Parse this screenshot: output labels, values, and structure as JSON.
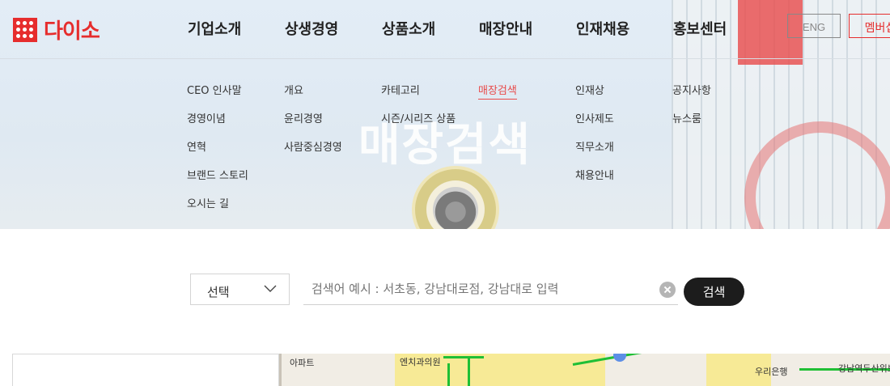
{
  "brand": {
    "logo_text": "다이소",
    "mark_text": "daiso"
  },
  "gnb": [
    {
      "label": "기업소개"
    },
    {
      "label": "상생경영"
    },
    {
      "label": "상품소개"
    },
    {
      "label": "매장안내"
    },
    {
      "label": "인재채용"
    },
    {
      "label": "홍보센터"
    }
  ],
  "lang_button": "ENG",
  "member_button": "멤버십",
  "submenu": {
    "col1": [
      "CEO 인사말",
      "경영이념",
      "연혁",
      "브랜드 스토리",
      "오시는 길"
    ],
    "col2": [
      "개요",
      "윤리경영",
      "사람중심경영"
    ],
    "col3": [
      "카테고리",
      "시즌/시리즈 상품"
    ],
    "col4": [
      "매장검색"
    ],
    "col5": [
      "인재상",
      "인사제도",
      "직무소개",
      "채용안내"
    ],
    "col6": [
      "공지사항",
      "뉴스룸"
    ]
  },
  "active_submenu": "매장검색",
  "hero": {
    "title": "매장검색"
  },
  "search": {
    "select_label": "선택",
    "placeholder": "검색어 예시 : 서초동, 강남대로점, 강남대로 입력",
    "button": "검색"
  },
  "map_labels": [
    "아파트",
    "엔치과의원",
    "우리은행",
    "강남역두산위브"
  ],
  "colors": {
    "brand_red": "#e62d2d",
    "accent": "#e84a4a",
    "button_dark": "#1c1c1c"
  }
}
